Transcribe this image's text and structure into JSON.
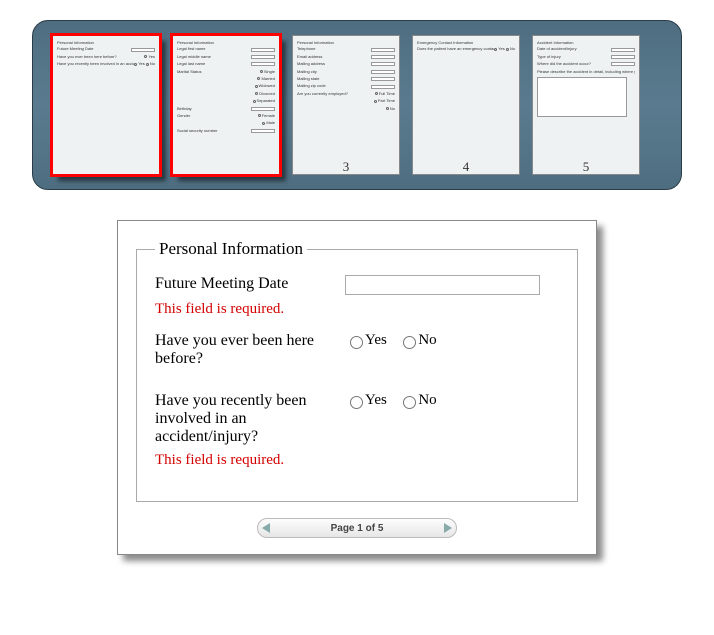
{
  "thumbs": [
    {
      "num": "1",
      "title": "Personal Information",
      "rows": [
        {
          "label": "Future Meeting Date",
          "input": true
        },
        {
          "label": "Have you ever been here before?",
          "opt": "Yes"
        },
        {
          "label": "Have you recently been involved in an accident/injury?",
          "opt": "Yes",
          "opt2": "No"
        }
      ]
    },
    {
      "num": "2",
      "title": "Personal Information",
      "rows": [
        {
          "label": "Legal first name",
          "input": true
        },
        {
          "label": "Legal middle name",
          "input": true
        },
        {
          "label": "Legal last name",
          "input": true
        },
        {
          "label": "Marital Status",
          "opt": "Single"
        },
        {
          "label": "",
          "opt": "Married"
        },
        {
          "label": "",
          "opt": "Widowed"
        },
        {
          "label": "",
          "opt": "Divorced"
        },
        {
          "label": "",
          "opt": "Separated"
        },
        {
          "label": "Birthday",
          "input": true
        },
        {
          "label": "Gender",
          "opt": "Female"
        },
        {
          "label": "",
          "opt": "Male"
        },
        {
          "label": "Social security number",
          "input": true
        }
      ]
    },
    {
      "num": "3",
      "title": "Personal Information",
      "rows": [
        {
          "label": "Telephone",
          "input": true
        },
        {
          "label": "Email address",
          "input": true
        },
        {
          "label": "Mailing address",
          "input": true
        },
        {
          "label": "Mailing city",
          "input": true
        },
        {
          "label": "Mailing state",
          "input": true
        },
        {
          "label": "Mailing zip code",
          "input": true
        },
        {
          "label": "Are you currently employed?",
          "opt": "Full Time"
        },
        {
          "label": "",
          "opt": "Part Time"
        },
        {
          "label": "",
          "opt": "No"
        }
      ]
    },
    {
      "num": "4",
      "title": "Emergency Contact Information",
      "rows": [
        {
          "label": "Does the patient have an emergency contact who does not live with them?",
          "opt": "Yes",
          "opt2": "No"
        }
      ]
    },
    {
      "num": "5",
      "title": "Accident Information",
      "rows": [
        {
          "label": "Date of accident/injury",
          "input": true
        },
        {
          "label": "Type of injury",
          "input": true
        },
        {
          "label": "Where did the accident occur?",
          "input": true
        },
        {
          "label": "Please describe the accident in detail, including where you were, what you were doing, roles of all those involved, passenger driver or pedestrian"
        }
      ],
      "textarea": true
    }
  ],
  "main": {
    "legend": "Personal Information",
    "field1_label": "Future Meeting Date",
    "error1": "This field is required.",
    "field2_label": "Have you ever been here before?",
    "field3_label": "Have you recently been involved in an accident/injury?",
    "error3": "This field is required.",
    "yes": "Yes",
    "no": "No"
  },
  "pager": {
    "text": "Page 1 of 5"
  }
}
